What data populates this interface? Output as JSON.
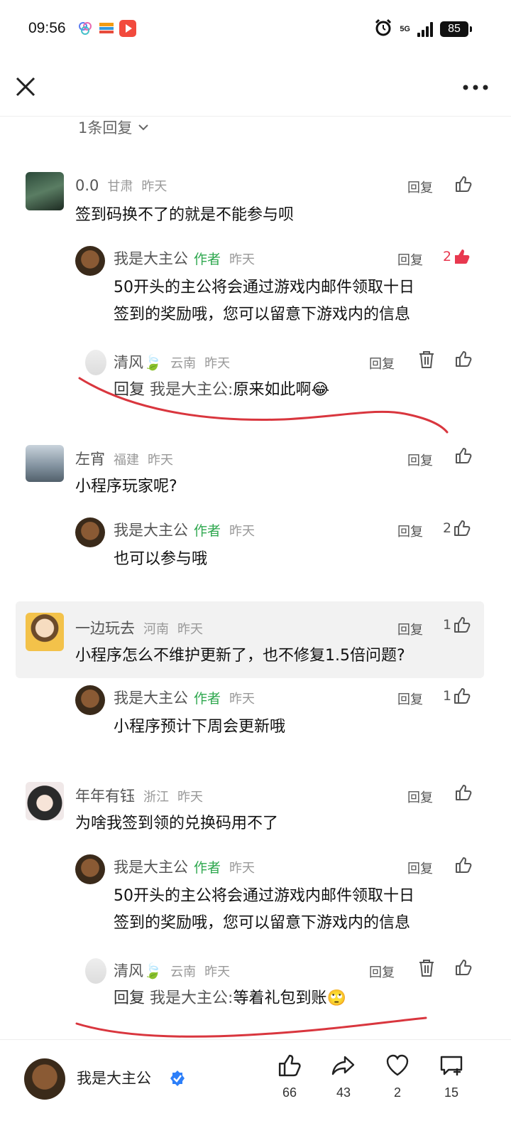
{
  "status_bar": {
    "time": "09:56",
    "network": "5G",
    "battery": "85"
  },
  "header": {
    "close_icon": "close-icon",
    "more_icon": "more-icon"
  },
  "replies_toggle": "1条回复",
  "comments": [
    {
      "name": "0.0",
      "location": "甘肃",
      "time": "昨天",
      "text": "签到码换不了的就是不能参与呗",
      "reply_label": "回复",
      "replies": [
        {
          "name": "我是大主公",
          "author_tag": "作者",
          "time": "昨天",
          "text_line1": "50开头的主公将会通过游戏内邮件领取十日",
          "text_line2": "签到的奖励哦，您可以留意下游戏内的信息",
          "reply_label": "回复",
          "likes": "2"
        },
        {
          "name": "清风🍃",
          "location": "云南",
          "time": "昨天",
          "prefix": "回复",
          "target": "我是大主公:",
          "text": "原来如此啊😂",
          "reply_label": "回复"
        }
      ]
    },
    {
      "name": "左宵",
      "location": "福建",
      "time": "昨天",
      "text": "小程序玩家呢?",
      "reply_label": "回复",
      "replies": [
        {
          "name": "我是大主公",
          "author_tag": "作者",
          "time": "昨天",
          "text": "也可以参与哦",
          "reply_label": "回复",
          "likes": "2"
        }
      ]
    },
    {
      "name": "一边玩去",
      "location": "河南",
      "time": "昨天",
      "text": "小程序怎么不维护更新了，也不修复1.5倍问题?",
      "reply_label": "回复",
      "likes": "1",
      "replies": [
        {
          "name": "我是大主公",
          "author_tag": "作者",
          "time": "昨天",
          "text": "小程序预计下周会更新哦",
          "reply_label": "回复",
          "likes": "1"
        }
      ]
    },
    {
      "name": "年年有钰",
      "location": "浙江",
      "time": "昨天",
      "text": "为啥我签到领的兑换码用不了",
      "reply_label": "回复",
      "replies": [
        {
          "name": "我是大主公",
          "author_tag": "作者",
          "time": "昨天",
          "text_line1": "50开头的主公将会通过游戏内邮件领取十日",
          "text_line2": "签到的奖励哦，您可以留意下游戏内的信息",
          "reply_label": "回复"
        },
        {
          "name": "清风🍃",
          "location": "云南",
          "time": "昨天",
          "prefix": "回复",
          "target": "我是大主公:",
          "text": "等着礼包到账🙄",
          "reply_label": "回复"
        }
      ]
    }
  ],
  "bottom_bar": {
    "author_name": "我是大主公",
    "likes": "66",
    "shares": "43",
    "favorites": "2",
    "comments": "15"
  },
  "colors": {
    "accent_red": "#e8384f",
    "author_green": "#2fa84f",
    "annotation_red": "#d9363e"
  }
}
